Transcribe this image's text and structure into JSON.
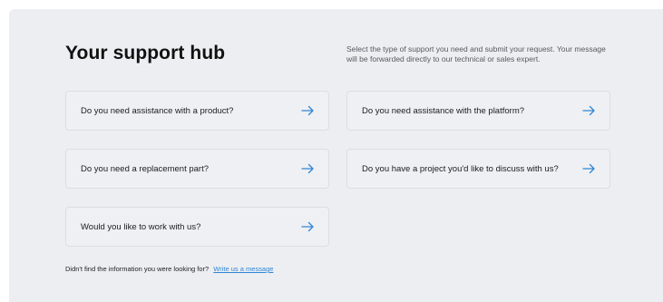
{
  "hub": {
    "title": "Your support hub",
    "intro": "Select the type of support you need and submit your request. Your message will be forwarded directly to our technical or sales expert.",
    "options": [
      {
        "label": "Do you need assistance with a product?",
        "icon": "arrow-right-icon"
      },
      {
        "label": "Do you need assistance with the platform?",
        "icon": "arrow-right-icon"
      },
      {
        "label": "Do you need a replacement part?",
        "icon": "arrow-right-icon"
      },
      {
        "label": "Do you have a project you'd like to discuss with us?",
        "icon": "arrow-right-icon"
      },
      {
        "label": "Would you like to work with us?",
        "icon": "arrow-right-icon"
      }
    ],
    "footer": {
      "text": "Didn't find the information you were looking for?",
      "link": "Write us a message"
    }
  },
  "colors": {
    "panel_background": "#edeef1",
    "card_border": "#dcdee3",
    "accent": "#2f86d6",
    "title": "#111111"
  }
}
